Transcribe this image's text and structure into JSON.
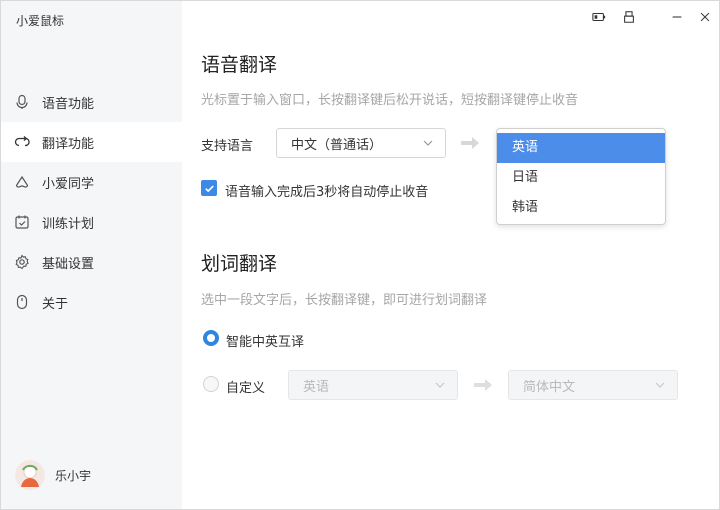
{
  "app": {
    "title": "小爱鼠标"
  },
  "sidebar": {
    "items": [
      {
        "label": "语音功能",
        "icon": "microphone-icon"
      },
      {
        "label": "翻译功能",
        "icon": "translate-icon",
        "active": true
      },
      {
        "label": "小爱同学",
        "icon": "xiaoai-icon"
      },
      {
        "label": "训练计划",
        "icon": "calendar-icon"
      },
      {
        "label": "基础设置",
        "icon": "gear-icon"
      },
      {
        "label": "关于",
        "icon": "mouse-icon"
      }
    ],
    "user": {
      "name": "乐小宇"
    }
  },
  "window_controls": [
    "battery-icon",
    "device-icon",
    "minimize-icon",
    "close-icon"
  ],
  "voice_translation": {
    "title": "语音翻译",
    "hint": "光标置于输入窗口，长按翻译键后松开说话，短按翻译键停止收音",
    "support_label": "支持语言",
    "source_language": "中文（普通话）",
    "target_options": [
      "英语",
      "日语",
      "韩语"
    ],
    "target_selected": "英语",
    "auto_stop_label": "语音输入完成后3秒将自动停止收音",
    "auto_stop_checked": true
  },
  "word_translation": {
    "title": "划词翻译",
    "hint": "选中一段文字后，长按翻译键，即可进行划词翻译",
    "mode_smart_label": "智能中英互译",
    "mode_custom_label": "自定义",
    "custom_source": "英语",
    "custom_target": "简体中文",
    "selected_mode": "smart"
  },
  "colors": {
    "accent": "#3d8ae6",
    "dropdown_highlight": "#4c8dea",
    "sidebar_bg": "#f5f6f8",
    "hint_text": "#a6a6a6"
  }
}
